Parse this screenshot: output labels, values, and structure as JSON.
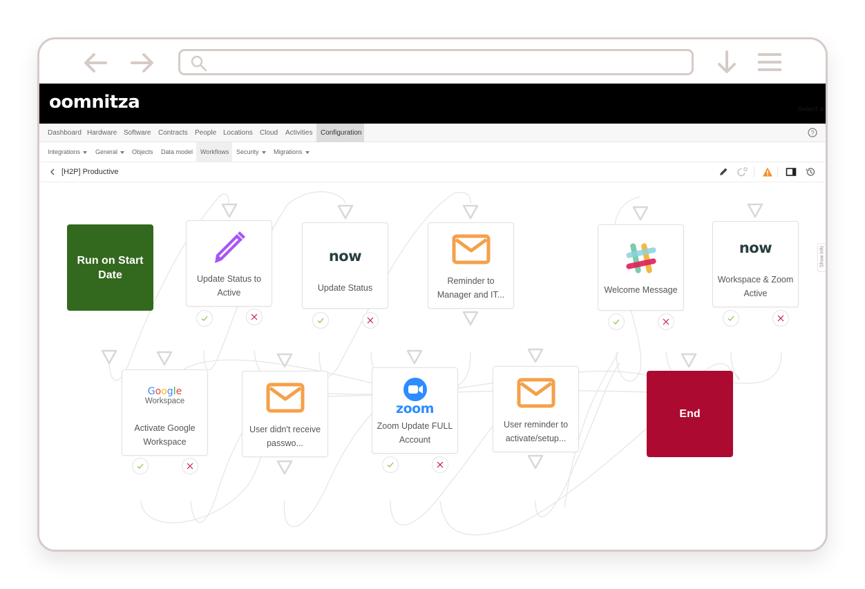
{
  "browser": {
    "back_icon": "arrow-left-icon",
    "forward_icon": "arrow-right-icon",
    "search_icon": "search-icon",
    "url_value": "",
    "download_icon": "arrow-down-icon",
    "menu_icon": "hamburger-menu-icon"
  },
  "app": {
    "logo": "oomnitza",
    "header_hint": "Select a p"
  },
  "main_nav": {
    "items": [
      {
        "label": "Dashboard",
        "active": false
      },
      {
        "label": "Hardware",
        "active": false
      },
      {
        "label": "Software",
        "active": false
      },
      {
        "label": "Contracts",
        "active": false
      },
      {
        "label": "People",
        "active": false
      },
      {
        "label": "Locations",
        "active": false
      },
      {
        "label": "Cloud",
        "active": false
      },
      {
        "label": "Activities",
        "active": false
      },
      {
        "label": "Configuration",
        "active": true
      }
    ],
    "help_icon": "question-circle-icon"
  },
  "sub_nav": {
    "items": [
      {
        "label": "Integrations",
        "dropdown": true
      },
      {
        "label": "General",
        "dropdown": true
      },
      {
        "label": "Objects",
        "dropdown": false
      },
      {
        "label": "Data model",
        "dropdown": false
      },
      {
        "label": "Workflows",
        "dropdown": false,
        "active": true
      },
      {
        "label": "Security",
        "dropdown": true
      },
      {
        "label": "Migrations",
        "dropdown": true
      }
    ]
  },
  "workflow": {
    "title": "[H2P] Productive",
    "toolbar": [
      "pencil-icon",
      "schedule-icon",
      "warning-icon",
      "panel-icon",
      "history-icon"
    ],
    "warning_color": "#f4902f",
    "show_info_label": "Show Info"
  },
  "nodes": [
    {
      "id": "start",
      "type": "start",
      "label": "Run on Start Date",
      "color": "#33691e"
    },
    {
      "id": "n1",
      "type": "action",
      "icon": "pencil-icon",
      "label": "Update Status to Active",
      "icon_color": "#a855f7"
    },
    {
      "id": "n2",
      "type": "action",
      "icon": "servicenow-logo",
      "icon_text": "now",
      "label": "Update Status"
    },
    {
      "id": "n3",
      "type": "action",
      "icon": "mail-icon",
      "label": "Reminder to Manager and IT...",
      "icon_color": "#f5a04a"
    },
    {
      "id": "n4",
      "type": "action",
      "icon": "slack-logo",
      "label": "Welcome Message"
    },
    {
      "id": "n5",
      "type": "action",
      "icon": "servicenow-logo",
      "icon_text": "now",
      "label": "Workspace & Zoom Active"
    },
    {
      "id": "n6",
      "type": "action",
      "icon": "google-workspace-logo",
      "icon_text": "Google",
      "icon_subtext": "Workspace",
      "label": "Activate Google Workspace"
    },
    {
      "id": "n7",
      "type": "action",
      "icon": "mail-icon",
      "label": "User didn't receive passwo...",
      "icon_color": "#f5a04a"
    },
    {
      "id": "n8",
      "type": "action",
      "icon": "zoom-logo",
      "icon_text": "zoom",
      "label": "Zoom Update FULL Account"
    },
    {
      "id": "n9",
      "type": "action",
      "icon": "mail-icon",
      "label": "User reminder to activate/setup...",
      "icon_color": "#f5a04a"
    },
    {
      "id": "end",
      "type": "end",
      "label": "End",
      "color": "#ac0a30"
    }
  ],
  "port_colors": {
    "success": "#8bc34a",
    "failure": "#c2185b"
  }
}
